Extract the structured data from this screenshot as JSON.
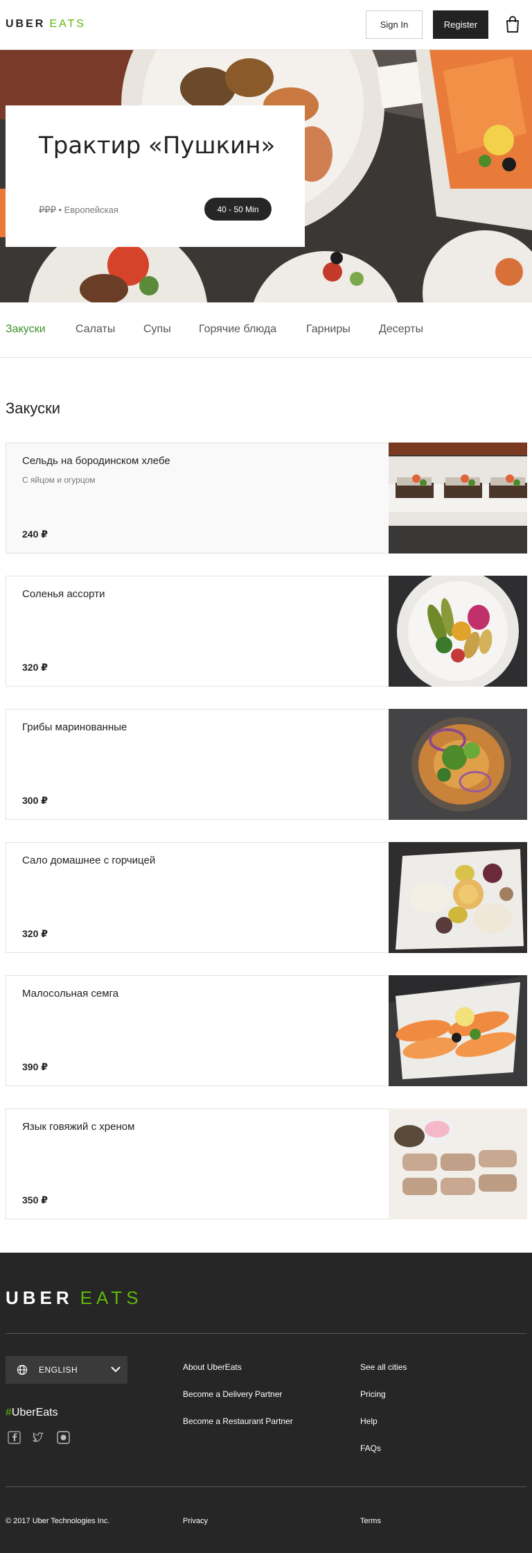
{
  "header": {
    "logo_uber": "UBER",
    "logo_eats": "EATS",
    "signin_label": "Sign In",
    "register_label": "Register"
  },
  "restaurant": {
    "name": "Трактир «Пушкин»",
    "price_level": "₽₽₽",
    "cuisine": " • Европейская",
    "eta": "40 - 50 Min"
  },
  "tabs": [
    {
      "label": "Закуски",
      "active": true
    },
    {
      "label": "Салаты"
    },
    {
      "label": "Супы"
    },
    {
      "label": "Горячие блюда"
    },
    {
      "label": "Гарниры"
    },
    {
      "label": "Десерты"
    }
  ],
  "section": {
    "title": "Закуски",
    "items": [
      {
        "name": "Сельдь на бородинском хлебе",
        "description": "С яйцом и огурцом",
        "price": "240 ₽"
      },
      {
        "name": "Соленья ассорти",
        "description": "",
        "price": "320 ₽"
      },
      {
        "name": "Грибы маринованные",
        "description": "",
        "price": "300 ₽"
      },
      {
        "name": "Сало домашнее с горчицей",
        "description": "",
        "price": "320 ₽"
      },
      {
        "name": "Малосольная семга",
        "description": "",
        "price": "390 ₽"
      },
      {
        "name": "Язык говяжий с хреном",
        "description": "",
        "price": "350 ₽"
      }
    ]
  },
  "footer": {
    "logo_uber": "UBER",
    "logo_eats": "EATS",
    "language": "ENGLISH",
    "hashtag_symbol": "#",
    "hashtag_text": "UberEats",
    "links_col1": [
      "About UberEats",
      "Become a Delivery Partner",
      "Become a Restaurant Partner"
    ],
    "links_col2": [
      "See all cities",
      "Pricing",
      "Help",
      "FAQs"
    ],
    "copyright": "© 2017 Uber Technologies Inc.",
    "privacy": "Privacy",
    "terms": "Terms"
  },
  "colors": {
    "brand_green": "#5fb709",
    "active_tab": "#3f8f2b",
    "footer_bg": "#262626"
  }
}
